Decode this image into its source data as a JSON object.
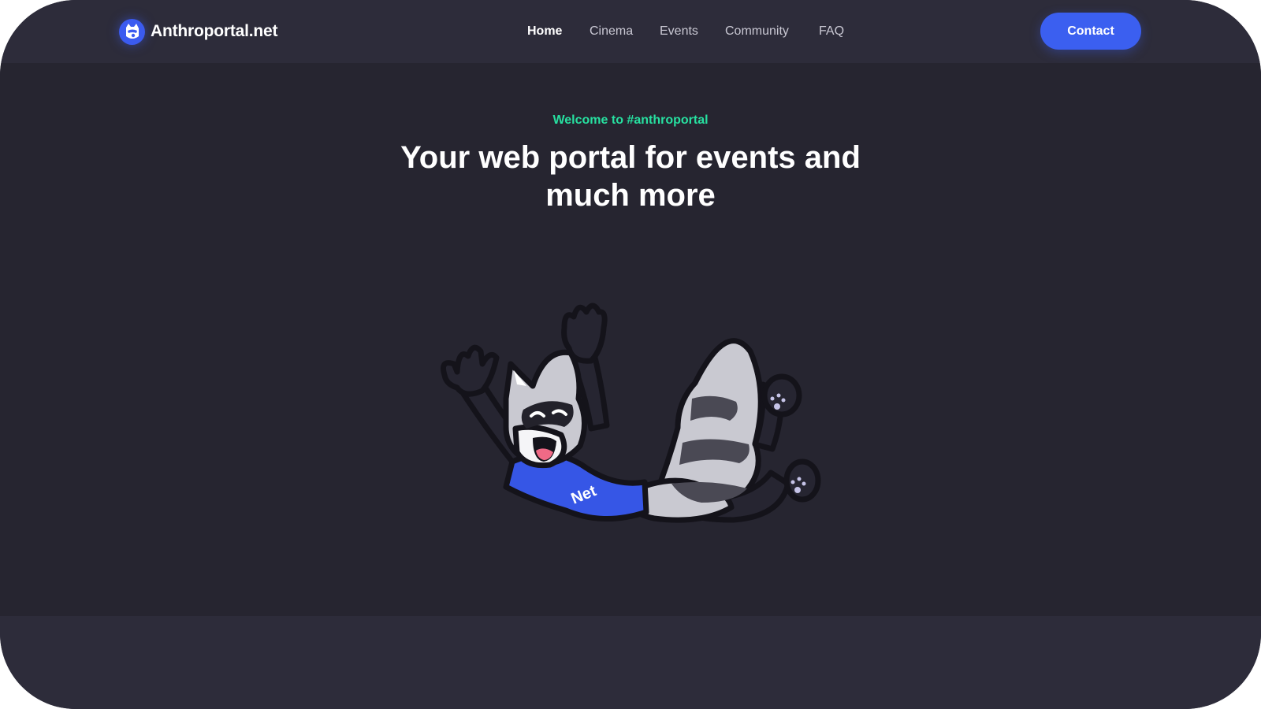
{
  "brand": {
    "name": "Anthroportal.net",
    "logo_icon": "raccoon-logo-icon"
  },
  "nav": {
    "items": [
      {
        "label": "Home",
        "active": true
      },
      {
        "label": "Cinema",
        "active": false
      },
      {
        "label": "Events",
        "active": false
      },
      {
        "label": "Community",
        "active": false
      },
      {
        "label": "FAQ",
        "active": false
      }
    ],
    "contact_label": "Contact"
  },
  "hero": {
    "eyebrow": "Welcome to #anthroportal",
    "headline": "Your web portal for events and much more",
    "mascot": {
      "icon": "raccoon-mascot-illustration",
      "shirt_text": "Net"
    }
  },
  "colors": {
    "accent": "#3b5ff0",
    "eyebrow": "#27e0a0",
    "header_bg": "#2d2c3a",
    "hero_bg": "#262530"
  }
}
